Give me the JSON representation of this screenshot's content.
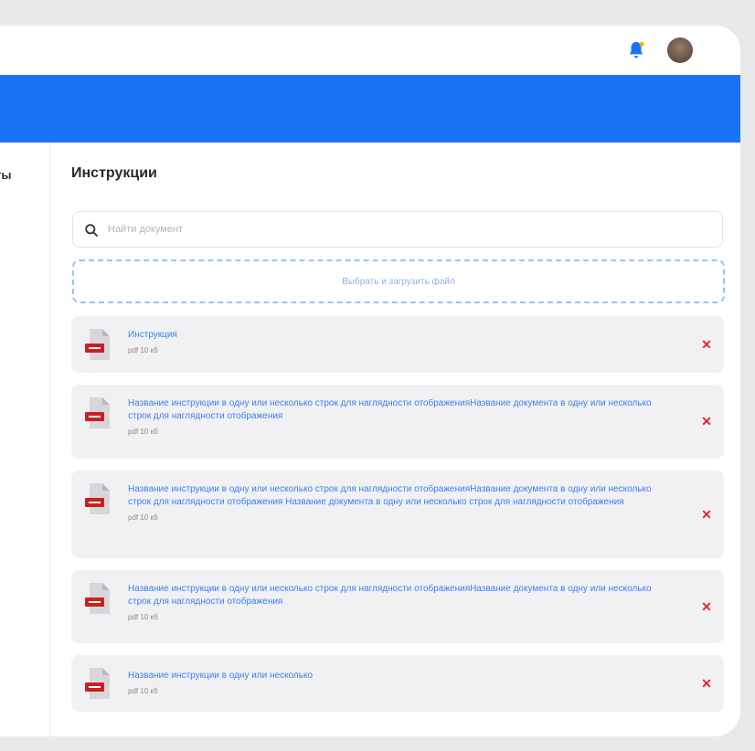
{
  "header": {
    "notification_icon": "bell-icon",
    "notification_dot_color": "#f2b500",
    "avatar_icon": "user-avatar"
  },
  "colors": {
    "accent": "#1a73f6",
    "delete": "#e02828",
    "link": "#3a7ff0",
    "pdf": "#cc1f1f"
  },
  "sidebar": {
    "partial_label": "ты"
  },
  "main": {
    "title": "Инструкции",
    "search": {
      "placeholder": "Найти документ"
    },
    "upload_label": "Выбрать и загрузить файл",
    "documents": [
      {
        "name": "Инструкция",
        "meta": "pdf 10 кб",
        "type_icon": "pdf-file-icon",
        "delete_icon": "close-icon"
      },
      {
        "name": "Название инструкции в одну или несколько строк для наглядности отображенияНазвание документа в одну или несколько строк для наглядности отображения",
        "meta": "pdf 10 кб",
        "type_icon": "pdf-file-icon",
        "delete_icon": "close-icon"
      },
      {
        "name": "Название инструкции в одну или несколько строк для наглядности отображенияНазвание документа в одну или несколько строк для наглядности отображения Название документа в одну или несколько строк для наглядности отображения",
        "meta": "pdf 10 кб",
        "type_icon": "pdf-file-icon",
        "delete_icon": "close-icon"
      },
      {
        "name": "Название инструкции в одну или несколько строк для наглядности отображенияНазвание документа в одну или несколько строк для наглядности отображения",
        "meta": "pdf 10 кб",
        "type_icon": "pdf-file-icon",
        "delete_icon": "close-icon"
      },
      {
        "name": "Название инструкции в одну или несколько",
        "meta": "pdf 10 кб",
        "type_icon": "pdf-file-icon",
        "delete_icon": "close-icon"
      }
    ]
  }
}
